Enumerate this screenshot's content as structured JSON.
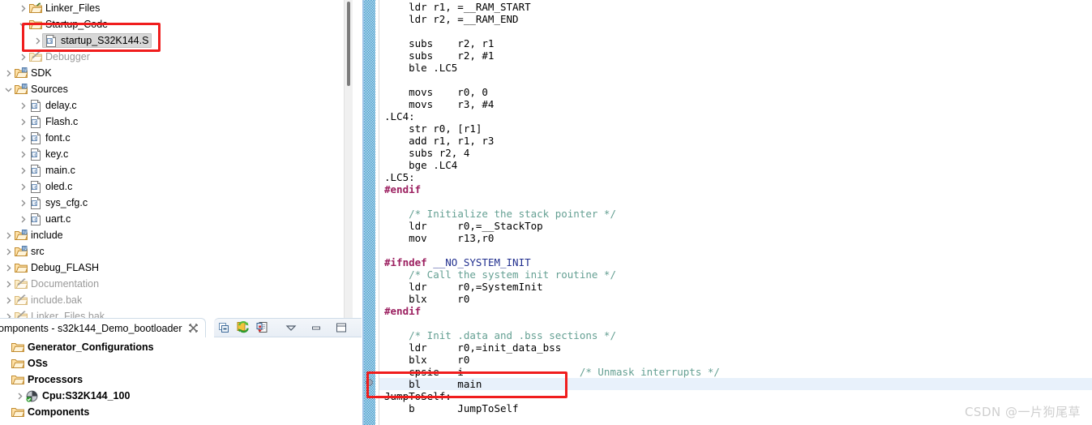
{
  "explorer": {
    "name": "project-explorer",
    "rows": [
      {
        "label": "Linker_Files",
        "icon": "folder-link-icon",
        "indent": 1,
        "twisty": "collapsed",
        "style": "normal"
      },
      {
        "label": "Startup_Code",
        "icon": "folder-open-icon",
        "indent": 1,
        "twisty": "expanded",
        "style": "normal"
      },
      {
        "label": "startup_S32K144.S",
        "icon": "assembly-file-icon",
        "indent": 2,
        "twisty": "collapsed",
        "style": "selected"
      },
      {
        "label": "Debugger",
        "icon": "folder-excluded-icon",
        "indent": 1,
        "twisty": "collapsed",
        "style": "dim"
      },
      {
        "label": "SDK",
        "icon": "source-folder-icon",
        "indent": 0,
        "twisty": "collapsed",
        "style": "normal"
      },
      {
        "label": "Sources",
        "icon": "source-folder-icon",
        "indent": 0,
        "twisty": "expanded",
        "style": "normal"
      },
      {
        "label": "delay.c",
        "icon": "c-file-icon",
        "indent": 1,
        "twisty": "collapsed",
        "style": "normal"
      },
      {
        "label": "Flash.c",
        "icon": "c-file-icon",
        "indent": 1,
        "twisty": "collapsed",
        "style": "normal"
      },
      {
        "label": "font.c",
        "icon": "c-file-icon",
        "indent": 1,
        "twisty": "collapsed",
        "style": "normal"
      },
      {
        "label": "key.c",
        "icon": "c-file-icon",
        "indent": 1,
        "twisty": "collapsed",
        "style": "normal"
      },
      {
        "label": "main.c",
        "icon": "c-file-icon",
        "indent": 1,
        "twisty": "collapsed",
        "style": "normal"
      },
      {
        "label": "oled.c",
        "icon": "c-file-icon",
        "indent": 1,
        "twisty": "collapsed",
        "style": "normal"
      },
      {
        "label": "sys_cfg.c",
        "icon": "c-file-icon",
        "indent": 1,
        "twisty": "collapsed",
        "style": "normal"
      },
      {
        "label": "uart.c",
        "icon": "c-file-icon",
        "indent": 1,
        "twisty": "collapsed",
        "style": "normal"
      },
      {
        "label": "include",
        "icon": "source-folder-icon",
        "indent": 0,
        "twisty": "collapsed",
        "style": "normal"
      },
      {
        "label": "src",
        "icon": "source-folder-icon",
        "indent": 0,
        "twisty": "collapsed",
        "style": "normal"
      },
      {
        "label": "Debug_FLASH",
        "icon": "folder-open-icon",
        "indent": 0,
        "twisty": "collapsed",
        "style": "normal"
      },
      {
        "label": "Documentation",
        "icon": "folder-excluded-icon",
        "indent": 0,
        "twisty": "collapsed",
        "style": "dim"
      },
      {
        "label": "include.bak",
        "icon": "folder-excluded-icon",
        "indent": 0,
        "twisty": "collapsed",
        "style": "dim"
      },
      {
        "label": "Linker_Files.bak",
        "icon": "folder-excluded-icon",
        "indent": 0,
        "twisty": "collapsed",
        "style": "dim"
      }
    ]
  },
  "components_view": {
    "tab_title": "omponents - s32k144_Demo_bootloader",
    "tab_close_glyph": "✖",
    "toolbar": [
      {
        "name": "collapse-all-icon",
        "tooltip": "Collapse All"
      },
      {
        "name": "refresh-icon",
        "tooltip": "Refresh"
      },
      {
        "name": "import-component-icon",
        "tooltip": "Import Component"
      },
      {
        "name": "view-menu-icon",
        "tooltip": "View Menu"
      },
      {
        "name": "minimize-icon",
        "tooltip": "Minimize"
      },
      {
        "name": "maximize-icon",
        "tooltip": "Maximize"
      }
    ],
    "rows": [
      {
        "label": "Generator_Configurations",
        "icon": "folder-open-icon",
        "indent": 0,
        "twisty": "none"
      },
      {
        "label": "OSs",
        "icon": "folder-open-icon",
        "indent": 0,
        "twisty": "none"
      },
      {
        "label": "Processors",
        "icon": "folder-open-icon",
        "indent": 0,
        "twisty": "none"
      },
      {
        "label": "Cpu:S32K144_100",
        "icon": "cpu-icon",
        "indent": 1,
        "twisty": "collapsed"
      },
      {
        "label": "Components",
        "icon": "folder-open-icon",
        "indent": 0,
        "twisty": "none"
      }
    ]
  },
  "editor": {
    "name": "source-editor",
    "file": "startup_S32K144.S",
    "highlighted_line_index": 31,
    "lines": [
      [
        {
          "t": "    ldr r1, =__RAM_START",
          "c": "kw"
        }
      ],
      [
        {
          "t": "    ldr r2, =__RAM_END",
          "c": "kw"
        }
      ],
      [
        {
          "t": "",
          "c": "kw"
        }
      ],
      [
        {
          "t": "    subs    r2, r1",
          "c": "kw"
        }
      ],
      [
        {
          "t": "    subs    r2, #1",
          "c": "kw"
        }
      ],
      [
        {
          "t": "    ble .LC5",
          "c": "kw"
        }
      ],
      [
        {
          "t": "",
          "c": "kw"
        }
      ],
      [
        {
          "t": "    movs    r0, 0",
          "c": "kw"
        }
      ],
      [
        {
          "t": "    movs    r3, #4",
          "c": "kw"
        }
      ],
      [
        {
          "t": ".LC4:",
          "c": "kw"
        }
      ],
      [
        {
          "t": "    str r0, [r1]",
          "c": "kw"
        }
      ],
      [
        {
          "t": "    add r1, r1, r3",
          "c": "kw"
        }
      ],
      [
        {
          "t": "    subs r2, 4",
          "c": "kw"
        }
      ],
      [
        {
          "t": "    bge .LC4",
          "c": "kw"
        }
      ],
      [
        {
          "t": ".LC5:",
          "c": "kw"
        }
      ],
      [
        {
          "t": "#endif",
          "c": "pp"
        }
      ],
      [
        {
          "t": "",
          "c": "kw"
        }
      ],
      [
        {
          "t": "    ",
          "c": "kw"
        },
        {
          "t": "/* Initialize the stack pointer */",
          "c": "cm"
        }
      ],
      [
        {
          "t": "    ldr     r0,=__StackTop",
          "c": "kw"
        }
      ],
      [
        {
          "t": "    mov     r13,r0",
          "c": "kw"
        }
      ],
      [
        {
          "t": "",
          "c": "kw"
        }
      ],
      [
        {
          "t": "#ifndef ",
          "c": "pp"
        },
        {
          "t": "__NO_SYSTEM_INIT",
          "c": "mc"
        }
      ],
      [
        {
          "t": "    ",
          "c": "kw"
        },
        {
          "t": "/* Call the system init routine */",
          "c": "cm"
        }
      ],
      [
        {
          "t": "    ldr     r0,=SystemInit",
          "c": "kw"
        }
      ],
      [
        {
          "t": "    blx     r0",
          "c": "kw"
        }
      ],
      [
        {
          "t": "#endif",
          "c": "pp"
        }
      ],
      [
        {
          "t": "",
          "c": "kw"
        }
      ],
      [
        {
          "t": "    ",
          "c": "kw"
        },
        {
          "t": "/* Init .data and .bss sections */",
          "c": "cm"
        }
      ],
      [
        {
          "t": "    ldr     r0,=init_data_bss",
          "c": "kw"
        }
      ],
      [
        {
          "t": "    blx     r0",
          "c": "kw"
        }
      ],
      [
        {
          "t": "    cpsie   i                   ",
          "c": "kw"
        },
        {
          "t": "/* Unmask interrupts */",
          "c": "cm"
        }
      ],
      [
        {
          "t": "    bl      main",
          "c": "kw"
        }
      ],
      [
        {
          "t": "JumpToSelf:",
          "c": "kw"
        }
      ],
      [
        {
          "t": "    b       JumpToSelf",
          "c": "kw"
        }
      ]
    ]
  },
  "annotations": [
    {
      "name": "annotation-box-startup-file",
      "color": "#f01d1d",
      "target": "startup_S32K144.S"
    },
    {
      "name": "annotation-box-bl-main",
      "color": "#f01d1d",
      "target": "bl      main"
    }
  ],
  "watermark": {
    "text": "CSDN @一片狗尾草"
  }
}
